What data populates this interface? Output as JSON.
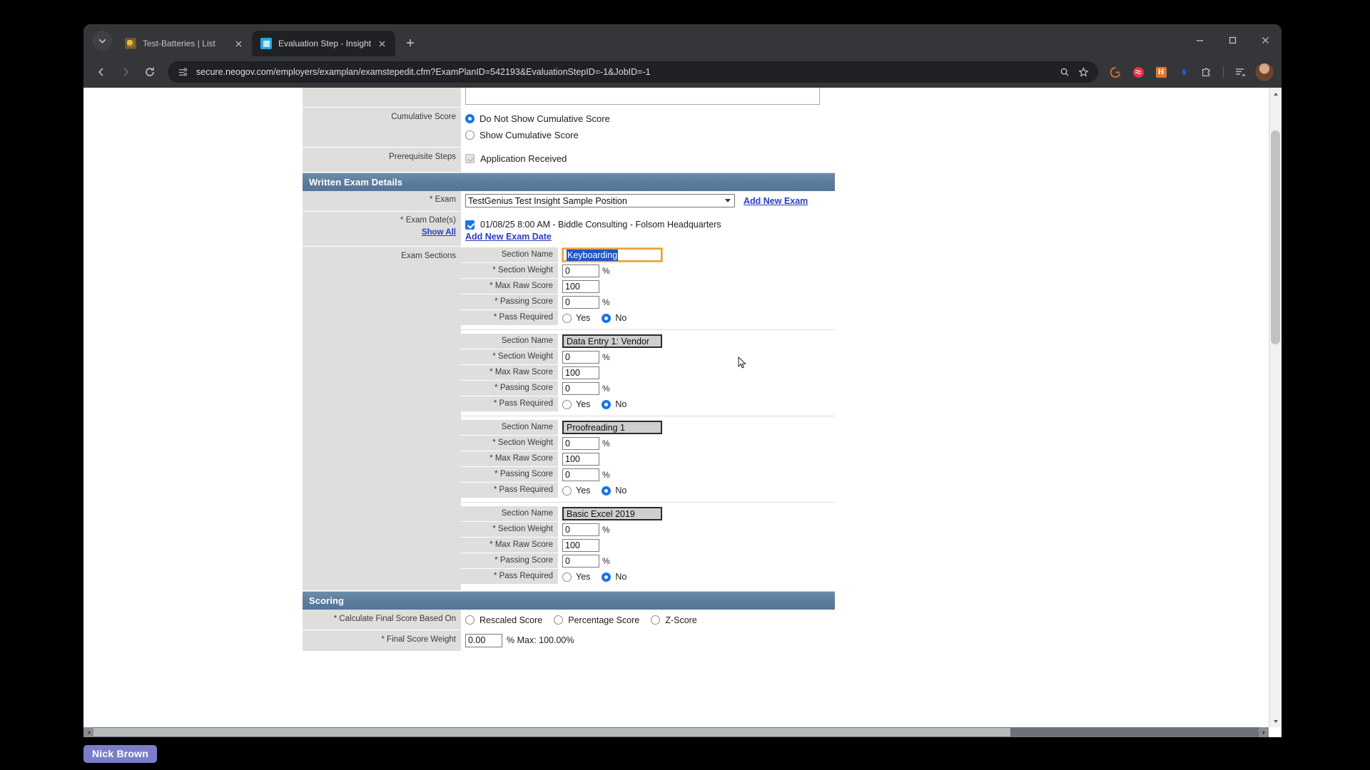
{
  "browser": {
    "tabs": [
      {
        "title": "Test-Batteries | List",
        "active": false,
        "favicon": "batteries-favicon"
      },
      {
        "title": "Evaluation Step - Insight",
        "active": true,
        "favicon": "insight-favicon"
      }
    ],
    "url": "secure.neogov.com/employers/examplan/examstepedit.cfm?ExamPlanID=542193&EvaluationStepID=-1&JobID=-1",
    "toolbar_icons": [
      "zoom-icon",
      "bookmark-star-icon",
      "grammarly-extension-icon",
      "extension-red-icon",
      "extension-h-icon",
      "extension-lightning-icon",
      "puzzle-extension-icon",
      "reading-list-icon",
      "profile-avatar"
    ],
    "window_controls": [
      "minimize-button",
      "maximize-button",
      "close-button"
    ]
  },
  "form": {
    "cumulative_score": {
      "label": "Cumulative Score",
      "options": [
        {
          "label": "Do Not Show Cumulative Score",
          "selected": true
        },
        {
          "label": "Show Cumulative Score",
          "selected": false
        }
      ]
    },
    "prerequisite_steps": {
      "label": "Prerequisite Steps",
      "items": [
        {
          "label": "Application Received",
          "checked": true,
          "disabled": true
        }
      ]
    },
    "written_exam_details": {
      "header": "Written Exam Details",
      "exam": {
        "label": "* Exam",
        "value": "TestGenius Test Insight Sample Position",
        "add_link": "Add New Exam"
      },
      "exam_dates": {
        "label": "* Exam Date(s)",
        "show_all": "Show All",
        "items": [
          {
            "label": "01/08/25 8:00 AM - Biddle Consulting - Folsom Headquarters",
            "checked": true
          }
        ],
        "add_link": "Add New Exam Date"
      },
      "exam_sections": {
        "label": "Exam Sections",
        "field_labels": {
          "name": "Section Name",
          "weight": "* Section Weight",
          "max_raw": "* Max Raw Score",
          "passing": "* Passing Score",
          "pass_required": "* Pass Required"
        },
        "yes_label": "Yes",
        "no_label": "No",
        "percent_symbol": "%",
        "sections": [
          {
            "name": "Keyboarding",
            "focused": true,
            "weight": "0",
            "max_raw": "100",
            "passing": "0",
            "pass_required": "No"
          },
          {
            "name": "Data Entry 1: Vendor",
            "focused": false,
            "weight": "0",
            "max_raw": "100",
            "passing": "0",
            "pass_required": "No"
          },
          {
            "name": "Proofreading 1",
            "focused": false,
            "weight": "0",
            "max_raw": "100",
            "passing": "0",
            "pass_required": "No"
          },
          {
            "name": "Basic Excel 2019",
            "focused": false,
            "weight": "0",
            "max_raw": "100",
            "passing": "0",
            "pass_required": "No"
          }
        ]
      }
    },
    "scoring": {
      "header": "Scoring",
      "calculate_label": "* Calculate Final Score Based On",
      "calculate_options": [
        {
          "label": "Rescaled Score",
          "selected": false
        },
        {
          "label": "Percentage Score",
          "selected": false
        },
        {
          "label": "Z-Score",
          "selected": false
        }
      ],
      "final_weight_label": "* Final Score Weight",
      "final_weight_value": "0.00",
      "final_weight_suffix": "% Max: 100.00%"
    }
  },
  "taskbar": {
    "badge": "Nick Brown"
  }
}
